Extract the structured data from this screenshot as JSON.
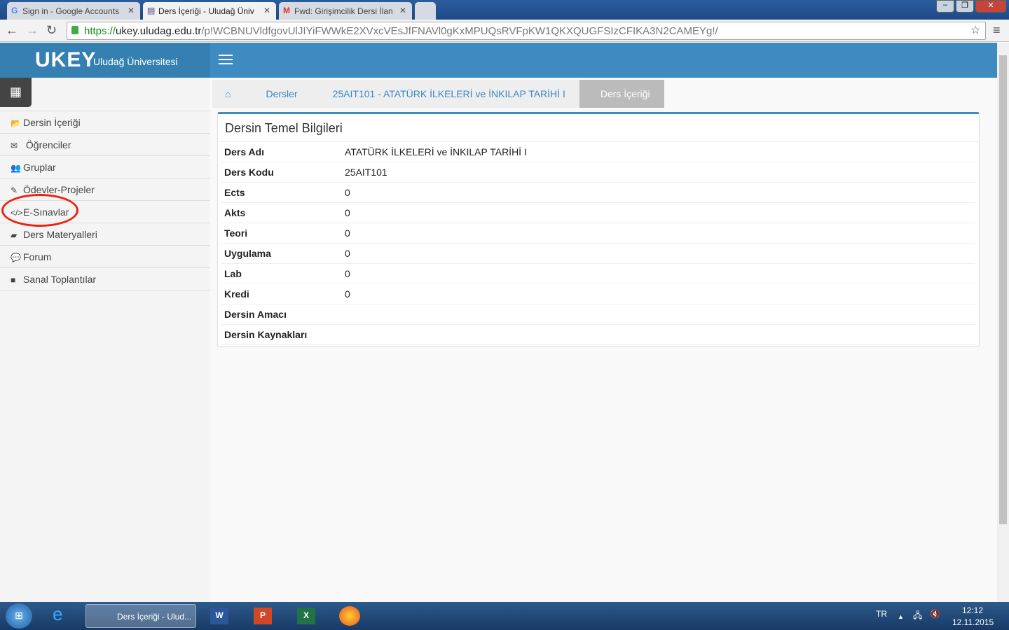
{
  "browser": {
    "tabs": [
      {
        "label": "Sign in - Google Accounts",
        "icon": "G"
      },
      {
        "label": "Ders İçeriği - Uludağ Üniv",
        "icon": "doc"
      },
      {
        "label": "Fwd: Girişimcilik Dersi İlan",
        "icon": "M"
      }
    ],
    "url_scheme": "https://",
    "url_host": "ukey.uludag.edu.tr",
    "url_path": "/p!WCBNUVldfgovUlJIYiFWWkE2XVxcVEsJfFNAVl0gKxMPUQsRVFpKW1QKXQUGFSIzCFIKA3N2CAMEYg!/"
  },
  "header": {
    "logo": "UKEY",
    "university": "Uludağ Üniversitesi"
  },
  "sidebar": {
    "items": [
      {
        "label": "Dersin İçeriği",
        "icon": "folder-open"
      },
      {
        "label": "Öğrenciler",
        "icon": "envelope"
      },
      {
        "label": "Gruplar",
        "icon": "users"
      },
      {
        "label": "Ödevler-Projeler",
        "icon": "edit"
      },
      {
        "label": "E-Sınavlar",
        "icon": "code"
      },
      {
        "label": "Ders Materyalleri",
        "icon": "book"
      },
      {
        "label": "Forum",
        "icon": "comments"
      },
      {
        "label": "Sanal Toplantılar",
        "icon": "video-camera"
      }
    ]
  },
  "breadcrumb": [
    "Dersler",
    "25AIT101 - ATATÜRK İLKELERİ ve İNKILAP TARİHİ I",
    "Ders İçeriği"
  ],
  "panel": {
    "title": "Dersin Temel Bilgileri",
    "rows": [
      {
        "k": "Ders Adı",
        "v": "ATATÜRK İLKELERİ ve İNKILAP TARİHİ I"
      },
      {
        "k": "Ders Kodu",
        "v": "25AIT101"
      },
      {
        "k": "Ects",
        "v": "0"
      },
      {
        "k": "Akts",
        "v": "0"
      },
      {
        "k": "Teori",
        "v": "0"
      },
      {
        "k": "Uygulama",
        "v": "0"
      },
      {
        "k": "Lab",
        "v": "0"
      },
      {
        "k": "Kredi",
        "v": "0"
      },
      {
        "k": "Dersin Amacı",
        "v": ""
      },
      {
        "k": "Dersin Kaynakları",
        "v": ""
      }
    ]
  },
  "taskbar": {
    "active_app": "Ders İçeriği - Ulud...",
    "lang": "TR",
    "time": "12:12",
    "date": "12.11.2015"
  },
  "annotation_color": "#e21"
}
